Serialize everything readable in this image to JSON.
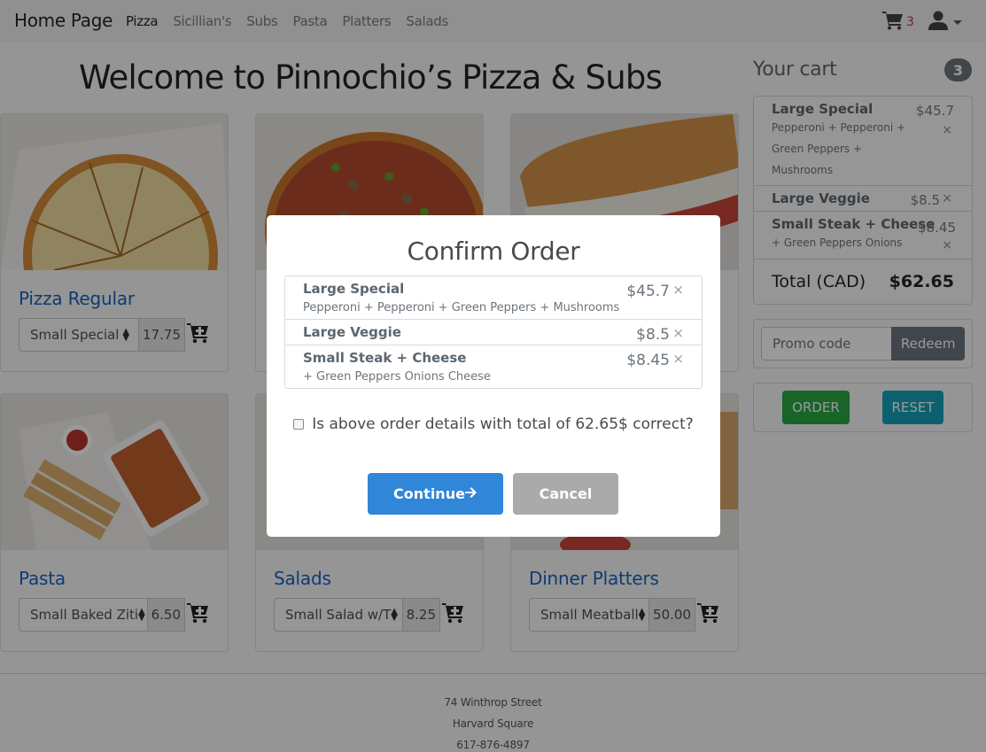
{
  "navbar": {
    "brand": "Home Page",
    "links": [
      {
        "label": "Pizza",
        "active": true
      },
      {
        "label": "Sicillian's",
        "active": false
      },
      {
        "label": "Subs",
        "active": false
      },
      {
        "label": "Pasta",
        "active": false
      },
      {
        "label": "Platters",
        "active": false
      },
      {
        "label": "Salads",
        "active": false
      }
    ],
    "cart_icon": "shopping-cart-icon",
    "cart_count": "3",
    "user_icon": "user-icon"
  },
  "page_title": "Welcome to Pinnochio’s Pizza & Subs",
  "products": [
    {
      "title": "Pizza Regular",
      "selected": "Small Special",
      "price": "17.75",
      "image": "cheese-pizza"
    },
    {
      "title": "",
      "selected": "",
      "price": "",
      "image": "veggie-pizza"
    },
    {
      "title": "",
      "selected": "",
      "price": "",
      "image": "sub-sandwich"
    },
    {
      "title": "Pasta",
      "selected": "Small Baked Ziti",
      "price": "6.50",
      "image": "baked-ziti"
    },
    {
      "title": "Salads",
      "selected": "Small Salad w/T",
      "price": "8.25",
      "image": "salad"
    },
    {
      "title": "Dinner Platters",
      "selected": "Small Meatball",
      "price": "50.00",
      "image": "platter"
    }
  ],
  "cart": {
    "title": "Your cart",
    "badge": "3",
    "items": [
      {
        "name": "Large Special",
        "price": "$45.7",
        "desc": "Pepperoni + Pepperoni + Green Peppers + Mushrooms"
      },
      {
        "name": "Large Veggie",
        "price": "$8.5",
        "desc": ""
      },
      {
        "name": "Small Steak + Cheese",
        "price": "$8.45",
        "desc": "+ Green Peppers Onions Cheese"
      }
    ],
    "remove_glyph": "×",
    "total_label": "Total (CAD)",
    "total_value": "$62.65",
    "promo_placeholder": "Promo code",
    "redeem_label": "Redeem",
    "order_label": "ORDER",
    "reset_label": "RESET",
    "colors": {
      "order": "#28a745",
      "reset": "#17a2b8",
      "redeem": "#6c757d"
    }
  },
  "footer": {
    "address": "74 Winthrop Street",
    "area": "Harvard Square",
    "phone": "617-876-4897"
  },
  "modal": {
    "title": "Confirm Order",
    "items": [
      {
        "name": "Large Special",
        "price": "$45.7",
        "desc": "Pepperoni + Pepperoni + Green Peppers + Mushrooms"
      },
      {
        "name": "Large Veggie",
        "price": "$8.5",
        "desc": ""
      },
      {
        "name": "Small Steak + Cheese",
        "price": "$8.45",
        "desc": "+ Green Peppers Onions Cheese"
      }
    ],
    "remove_glyph": "×",
    "confirm_checked": false,
    "confirm_text": "Is above order details with total of 62.65$ correct?",
    "continue_label": "Continue",
    "continue_icon": "arrow-right-icon",
    "cancel_label": "Cancel",
    "colors": {
      "continue": "#3086d8",
      "cancel": "#aaaaaa"
    }
  }
}
